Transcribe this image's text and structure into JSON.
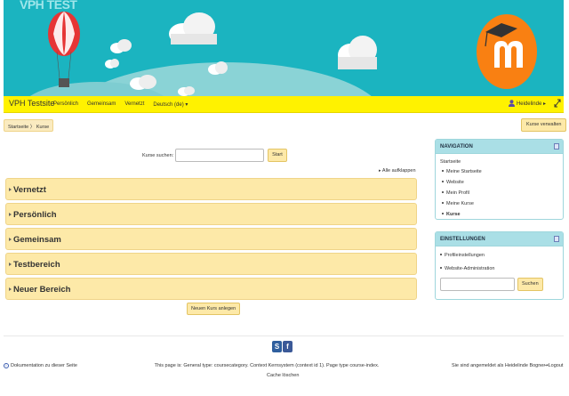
{
  "banner": {
    "title": "VPH TEST"
  },
  "navbar": {
    "brand": "VPH Testsite",
    "items": [
      {
        "label": "Persönlich"
      },
      {
        "label": "Gemeinsam"
      },
      {
        "label": "Vernetzt"
      },
      {
        "label": "Deutsch (de) ▾"
      }
    ],
    "user": "Heidelinde ▸"
  },
  "breadcrumb": {
    "home": "Startseite",
    "sep": "〉",
    "current": "Kurse"
  },
  "manage_button": "Kurse verwalten",
  "search": {
    "label": "Kurse suchen:",
    "value": "",
    "button": "Start"
  },
  "expand_all": "Alle aufklappen",
  "categories": [
    {
      "label": "Vernetzt"
    },
    {
      "label": "Persönlich"
    },
    {
      "label": "Gemeinsam"
    },
    {
      "label": "Testbereich"
    },
    {
      "label": "Neuer Bereich"
    }
  ],
  "new_course_button": "Neuen Kurs anlegen",
  "navigation_block": {
    "title": "NAVIGATION",
    "root": "Startseite",
    "items": [
      {
        "label": "Meine Startseite"
      },
      {
        "label": "Website"
      },
      {
        "label": "Mein Profil"
      },
      {
        "label": "Meine Kurse"
      },
      {
        "label": "Kurse"
      }
    ]
  },
  "settings_block": {
    "title": "EINSTELLUNGEN",
    "items": [
      {
        "label": "Profileinstellungen"
      },
      {
        "label": "Website-Administration"
      }
    ],
    "search_value": "",
    "search_button": "Suchen"
  },
  "footer": {
    "doc_link": "Dokumentation zu dieser Seite",
    "page_info": "This page is: General type: coursecategory. Context Kernsystem (context id 1). Page type course-index.",
    "cache_link": "Cache löschen",
    "login_info": "Sie sind angemeldet als Heidelinde Bogner",
    "logout": "Logout"
  },
  "colors": {
    "banner": "#1bb4c0",
    "navbar": "#fff200",
    "category_bg": "#fde9a8",
    "block_header": "#aadfe6"
  }
}
